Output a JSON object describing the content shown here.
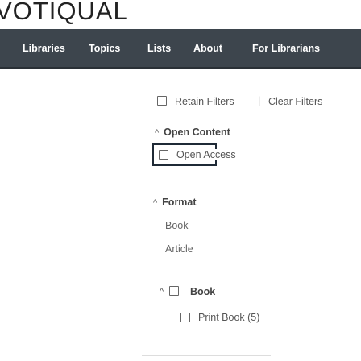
{
  "brand": {
    "logo_text": "VOTIQUAL"
  },
  "nav": {
    "items": [
      {
        "label": "Libraries"
      },
      {
        "label": "Topics"
      },
      {
        "label": "Lists"
      },
      {
        "label": "About"
      },
      {
        "label": "For Librarians"
      }
    ]
  },
  "filters": {
    "retain_label": "Retain Filters",
    "separator": "|",
    "clear_label": "Clear Filters"
  },
  "open_content": {
    "heading": "Open Content",
    "option_label": "Open Access"
  },
  "format": {
    "heading": "Format",
    "options": [
      "Book",
      "Article"
    ],
    "book_group": {
      "heading": "Book",
      "sub_option": "Print Book (5)"
    }
  },
  "icons": {
    "caret": "caret-up-icon",
    "checkbox": "checkbox-unchecked-icon"
  },
  "colors": {
    "nav_background": "#3d454d",
    "focus_border": "#1f2a36"
  }
}
